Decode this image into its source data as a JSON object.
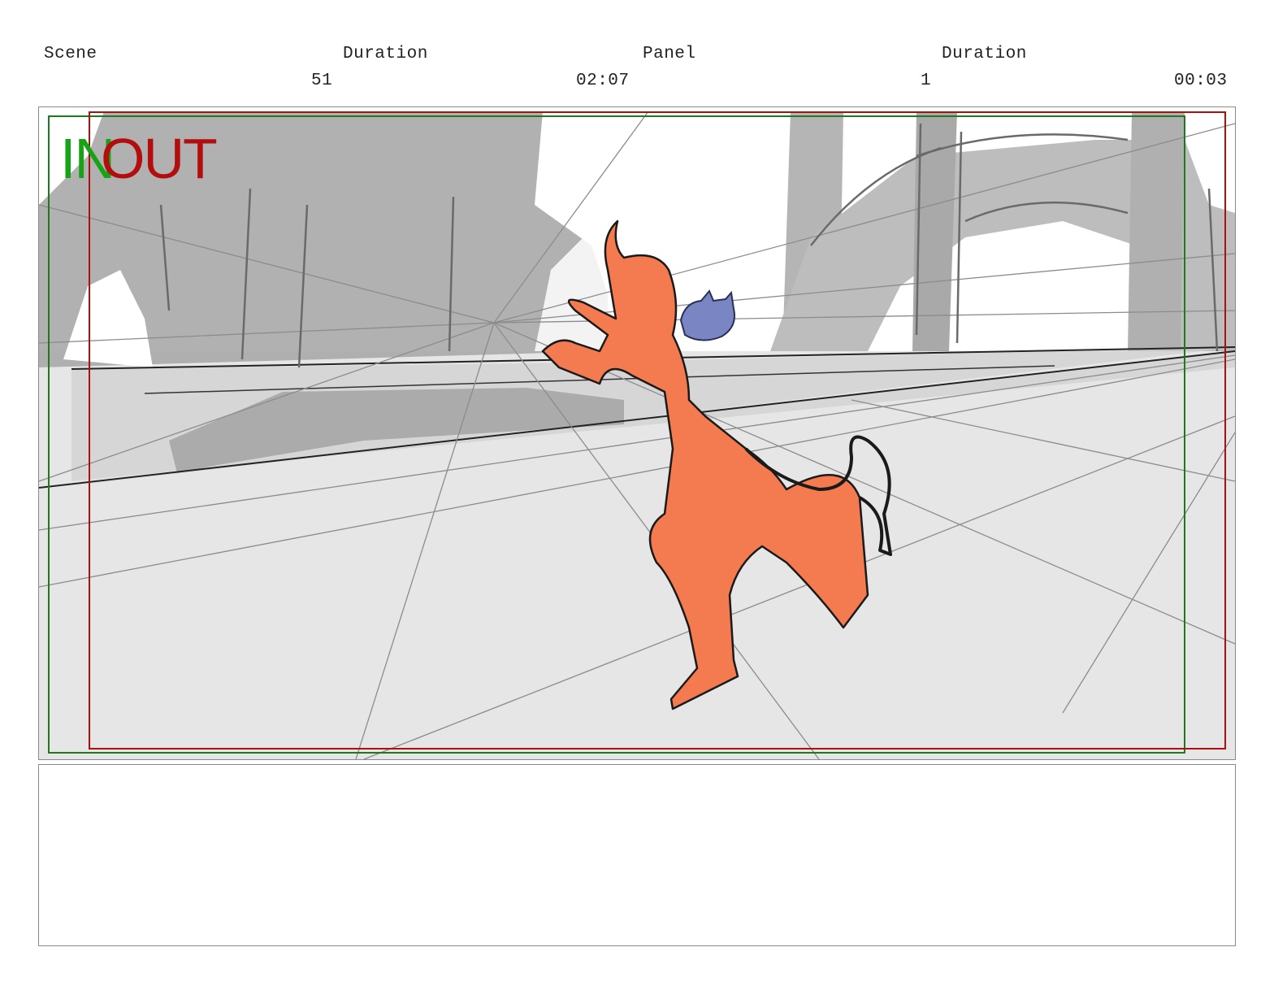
{
  "header": {
    "scene_label": "Scene",
    "scene_duration_label": "Duration",
    "panel_label": "Panel",
    "panel_duration_label": "Duration",
    "scene_number": "51",
    "scene_duration": "02:07",
    "panel_number": "1",
    "panel_duration": "00:03"
  },
  "panel": {
    "in_marker": "IN",
    "out_marker": "OUT"
  },
  "notes": {
    "text": ""
  },
  "colors": {
    "safe_in_frame": "#1e7a1e",
    "safe_out_frame": "#b30d0d",
    "character_fill": "#f47a50",
    "creature_fill": "#7a86c4",
    "background_shadow": "#a9a9a9",
    "ground": "#e6e6e6"
  }
}
